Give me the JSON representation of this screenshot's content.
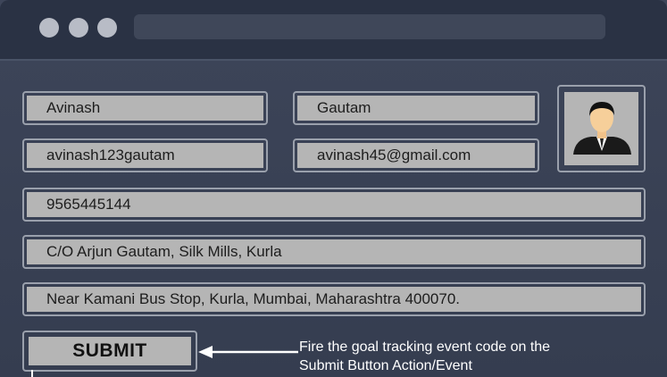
{
  "window": {
    "dots": [
      "dot-1",
      "dot-2",
      "dot-3"
    ]
  },
  "form": {
    "first_name": "Avinash",
    "last_name": "Gautam",
    "username": "avinash123gautam",
    "email": "avinash45@gmail.com",
    "phone": "9565445144",
    "address_line1": "C/O Arjun Gautam, Silk Mills, Kurla",
    "address_line2": "Near Kamani Bus Stop, Kurla, Mumbai, Maharashtra 400070.",
    "submit_label": "SUBMIT"
  },
  "annotation": {
    "line1": "Fire the goal tracking event code on the",
    "line2": "Submit Button Action/Event"
  },
  "icons": {
    "avatar": "user-avatar-icon",
    "arrow": "left-arrow-icon"
  }
}
